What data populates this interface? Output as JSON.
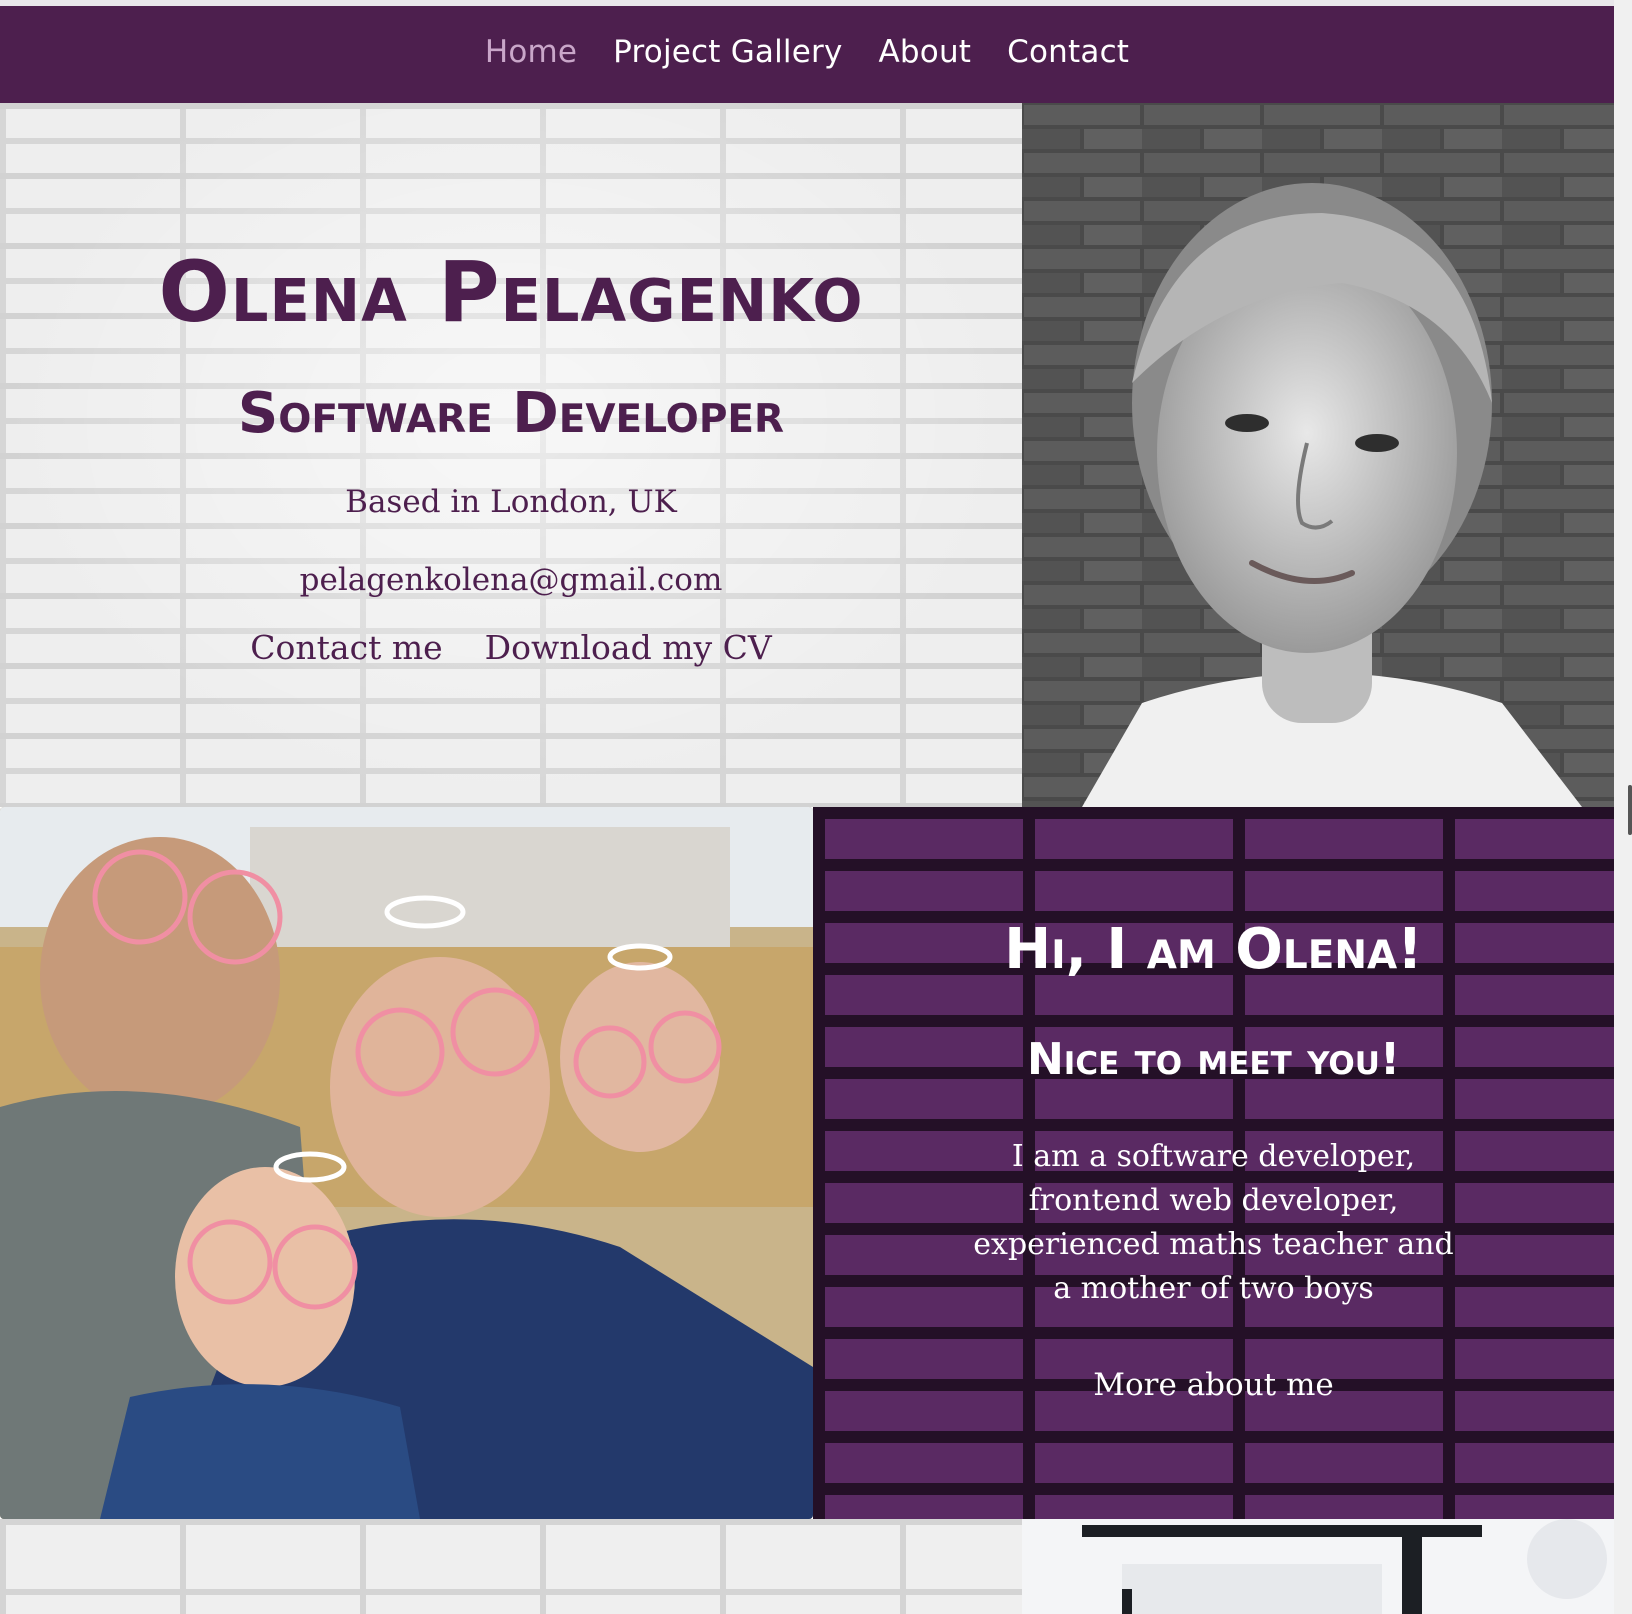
{
  "nav": {
    "items": [
      {
        "label": "Home",
        "active": true
      },
      {
        "label": "Project Gallery",
        "active": false
      },
      {
        "label": "About",
        "active": false
      },
      {
        "label": "Contact",
        "active": false
      }
    ]
  },
  "hero": {
    "name": "Olena Pelagenko",
    "role": "Software Developer",
    "location": "Based in London, UK",
    "email": "pelagenkolena@gmail.com",
    "contact_link": "Contact me",
    "cv_link": "Download my CV"
  },
  "intro": {
    "greeting": "Hi, I am Olena!",
    "subtitle": "Nice to meet you!",
    "bio": "I am a software developer, frontend web developer, experienced maths teacher and a mother of two boys",
    "more_link": "More about me"
  },
  "colors": {
    "brand": "#4d1f4e",
    "nav_active": "#c9a6c9",
    "intro_bg": "#5a2a63"
  }
}
